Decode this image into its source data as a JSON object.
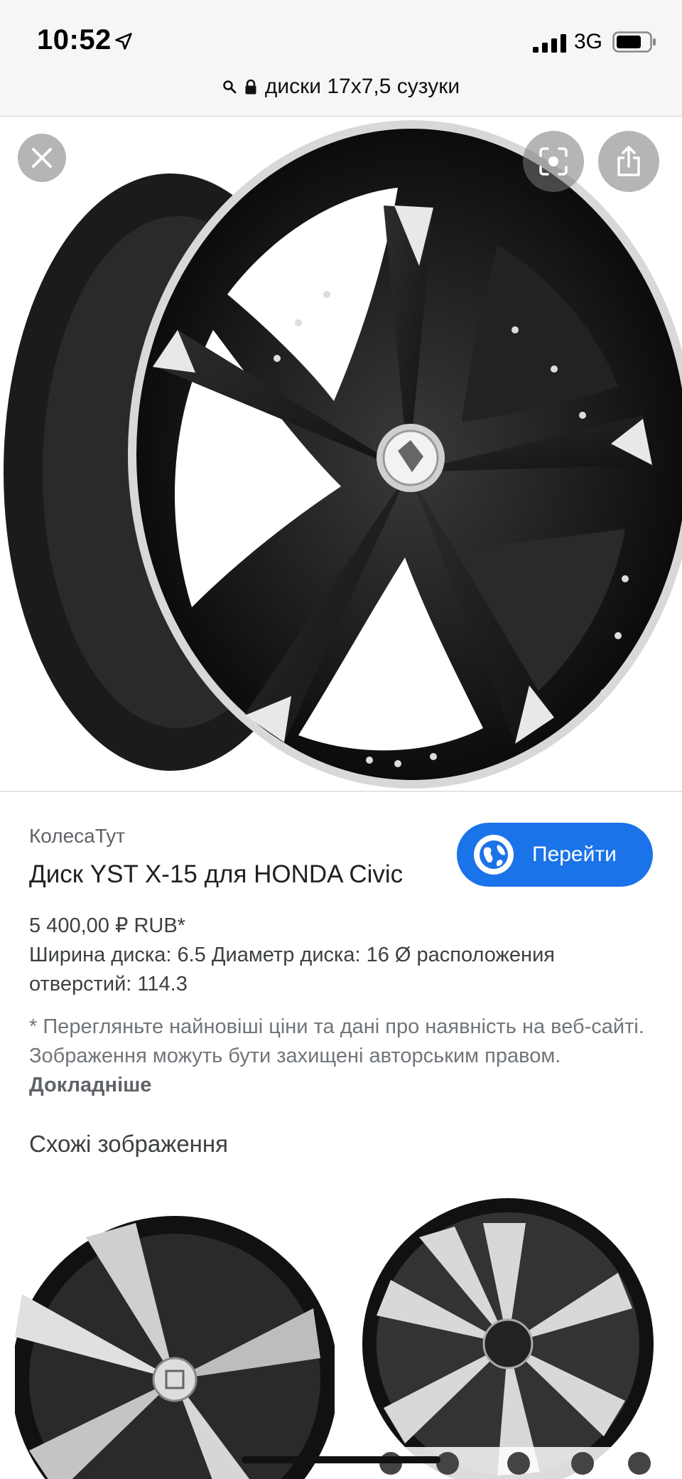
{
  "status_bar": {
    "time": "10:52",
    "network": "3G",
    "icons": [
      "location-arrow-icon",
      "signal-icon",
      "battery-icon"
    ]
  },
  "address_bar": {
    "query": "диски 17x7,5 сузуки",
    "icons": [
      "search-icon",
      "lock-icon"
    ]
  },
  "viewer": {
    "buttons": [
      "close-icon",
      "lens-icon",
      "share-icon"
    ]
  },
  "result": {
    "source": "КолесаТут",
    "title": "Диск YST X-15 для HONDA Civic",
    "visit_label": "Перейти",
    "price": "5 400,00 ₽ RUB*",
    "specs": "Ширина диска: 6.5 Диаметр диска: 16 Ø расположения отверстий: 114.3",
    "disclaimer": "* Перегляньте найновіші ціни та дані про наявність на веб-сайті. Зображення можуть бути захищені авторським правом.",
    "disclaimer_link": "Докладніше"
  },
  "similar": {
    "title": "Схожі зображення",
    "thumbnails": [
      "wheel-thumbnail-1",
      "wheel-thumbnail-2"
    ]
  },
  "colors": {
    "accent": "#1a73e8",
    "text": "#202124",
    "muted": "#5f6368"
  }
}
